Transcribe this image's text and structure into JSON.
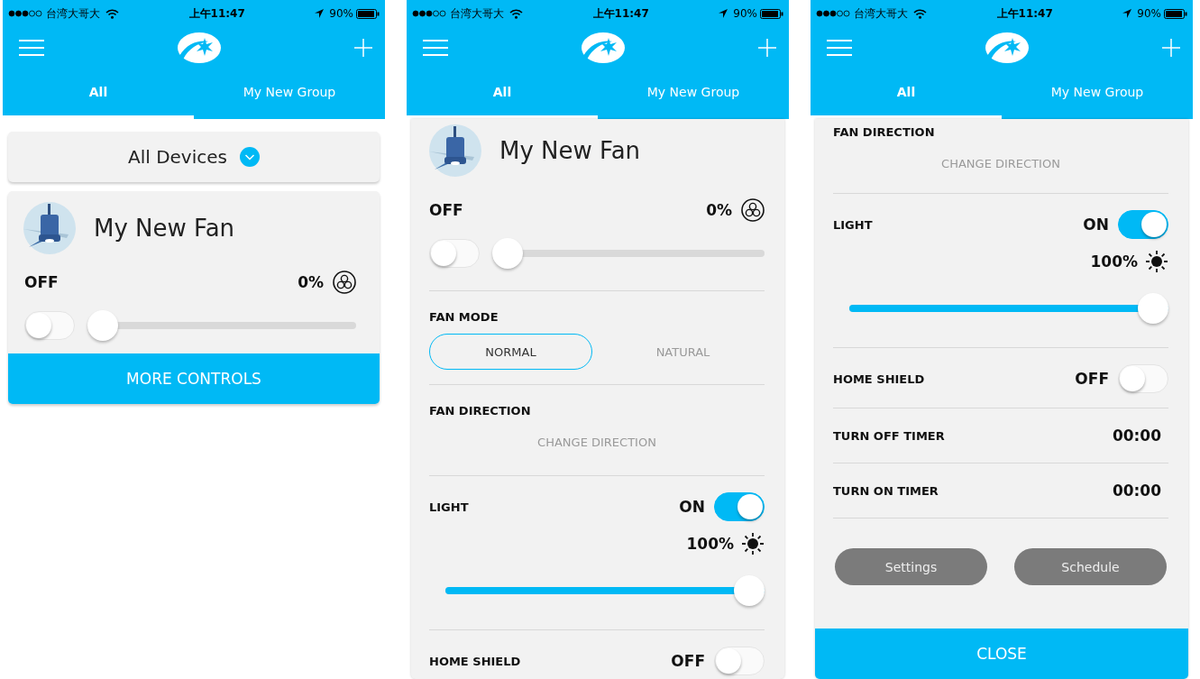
{
  "screens": [
    {
      "status_bar": {
        "carrier": "台湾大哥大",
        "time": "上午11:47",
        "battery": "90%"
      },
      "tabs": [
        {
          "label": "All",
          "selected": true
        },
        {
          "label": "My New Group",
          "selected": false
        }
      ],
      "kind": "list",
      "filter": "All Devices",
      "devices": [
        {
          "name": "My New Fan",
          "state": "OFF",
          "on": false,
          "speed": "0%",
          "level": 0,
          "button": "MORE CONTROLS"
        }
      ]
    },
    {
      "status_bar": {
        "carrier": "台湾大哥大",
        "time": "上午11:47",
        "battery": "90%"
      },
      "tabs": [
        {
          "label": "All",
          "selected": true
        },
        {
          "label": "My New Group",
          "selected": false
        }
      ],
      "kind": "detail",
      "sections": [
        {
          "kind": "device",
          "name": "My New Fan"
        },
        {
          "kind": "fan",
          "state": "OFF",
          "on": false,
          "speed": "0%",
          "level": 0
        },
        {
          "kind": "mode",
          "title": "FAN MODE",
          "options": [
            {
              "label": "NORMAL",
              "selected": true
            },
            {
              "label": "NATURAL",
              "selected": false
            }
          ]
        },
        {
          "kind": "direction",
          "title": "FAN DIRECTION",
          "action": "CHANGE DIRECTION"
        },
        {
          "kind": "light",
          "title": "LIGHT",
          "state": "ON",
          "on": true,
          "brightness": "100%",
          "level": 1
        },
        {
          "kind": "toggle",
          "title": "HOME SHIELD",
          "state": "OFF",
          "on": false
        }
      ]
    },
    {
      "status_bar": {
        "carrier": "台湾大哥大",
        "time": "上午11:47",
        "battery": "90%"
      },
      "tabs": [
        {
          "label": "All",
          "selected": true
        },
        {
          "label": "My New Group",
          "selected": false
        }
      ],
      "kind": "detail",
      "sections": [
        {
          "kind": "direction",
          "title": "FAN DIRECTION",
          "action": "CHANGE DIRECTION"
        },
        {
          "kind": "light",
          "title": "LIGHT",
          "state": "ON",
          "on": true,
          "brightness": "100%",
          "level": 1
        },
        {
          "kind": "toggle",
          "title": "HOME SHIELD",
          "state": "OFF",
          "on": false
        },
        {
          "kind": "timer",
          "title": "TURN OFF TIMER",
          "value": "00:00"
        },
        {
          "kind": "timer",
          "title": "TURN ON TIMER",
          "value": "00:00"
        },
        {
          "kind": "actions",
          "buttons": [
            "Settings",
            "Schedule"
          ]
        }
      ],
      "close_button": "CLOSE"
    }
  ]
}
